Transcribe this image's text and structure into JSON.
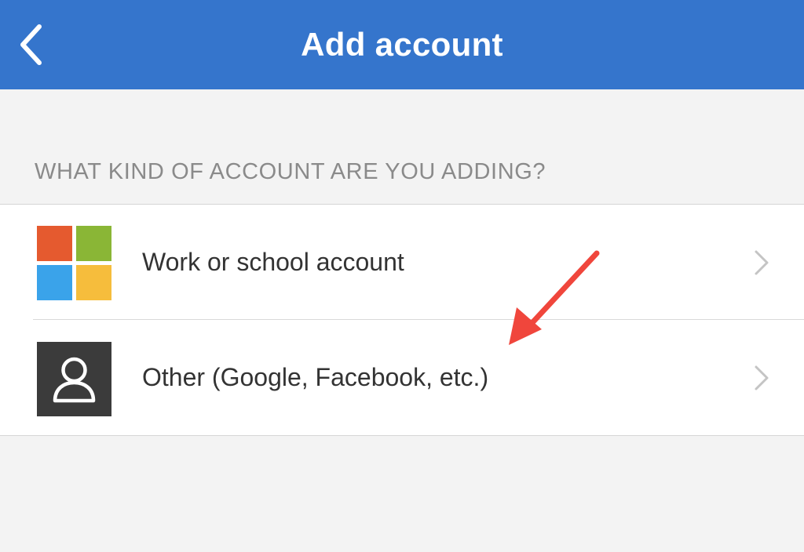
{
  "header": {
    "title": "Add account",
    "back_icon": "chevron-left-icon",
    "background_color": "#3575cc"
  },
  "section": {
    "label": "WHAT KIND OF ACCOUNT ARE YOU ADDING?"
  },
  "options": [
    {
      "label": "Work or school account",
      "icon": "microsoft-logo-icon",
      "tile_colors": [
        "#e55a2f",
        "#8ab636",
        "#3aa3ea",
        "#f6bd3c"
      ]
    },
    {
      "label": "Other (Google, Facebook, etc.)",
      "icon": "person-icon",
      "icon_background": "#3b3b3b"
    }
  ],
  "annotation": {
    "icon": "arrow-icon",
    "color": "#f0463c"
  }
}
